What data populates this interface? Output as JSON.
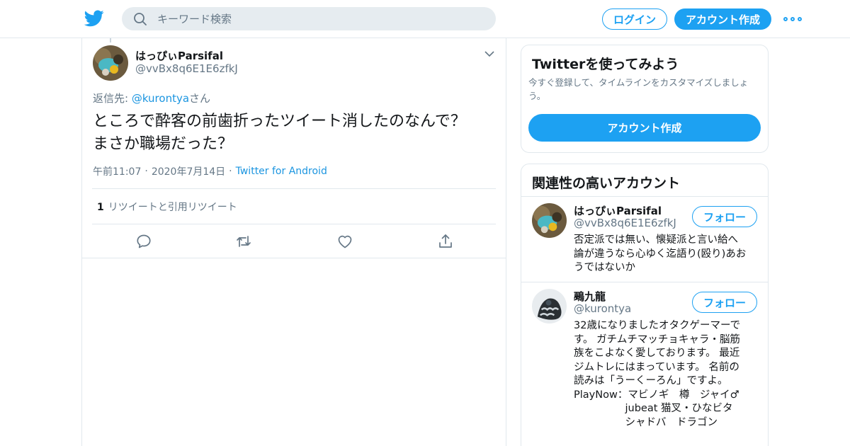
{
  "header": {
    "search_placeholder": "キーワード検索",
    "login_label": "ログイン",
    "signup_label": "アカウント作成"
  },
  "tweet": {
    "author_name": "はっぴぃParsifal",
    "author_handle": "@vvBx8q6E1E6zfkJ",
    "reply_to_prefix": "返信先: ",
    "reply_to_mention": "@kurontya",
    "reply_to_suffix": "さん",
    "text_line1": "ところで酔客の前歯折ったツイート消したのなんで？",
    "text_line2": "まさか職場だった？",
    "time": "午前11:07",
    "date": "2020年7月14日",
    "source": "Twitter for Android",
    "retweet_count": "1",
    "retweet_label": "リツイートと引用リツイート"
  },
  "signup_card": {
    "title": "Twitterを使ってみよう",
    "description": "今すぐ登録して、タイムラインをカスタマイズしましょう。",
    "button_label": "アカウント作成"
  },
  "related": {
    "title": "関連性の高いアカウント",
    "accounts": [
      {
        "name": "はっぴぃParsifal",
        "handle": "@vvBx8q6E1E6zfkJ",
        "follow_label": "フォロー",
        "bio": "否定派では無い、懐疑派と言い給へ\n論が違うなら心ゆく迄語り(殴り)あお\nうではないか"
      },
      {
        "name": "鵐九龍",
        "handle": "@kurontya",
        "follow_label": "フォロー",
        "bio": "32歳になりましたオタクゲーマーで\nす。 ガチムチマッチョキャラ・脳筋\n族をこよなく愛しております。 最近\nジムトレにはまっています。 名前の\n読みは「うーくーろん」ですよ。\nPlayNow：マビノギ　樽　ジャイ♂\n　　　　　jubeat 猫叉・ひなビタ\n　　　　　シャドバ　ドラゴン"
      }
    ]
  }
}
